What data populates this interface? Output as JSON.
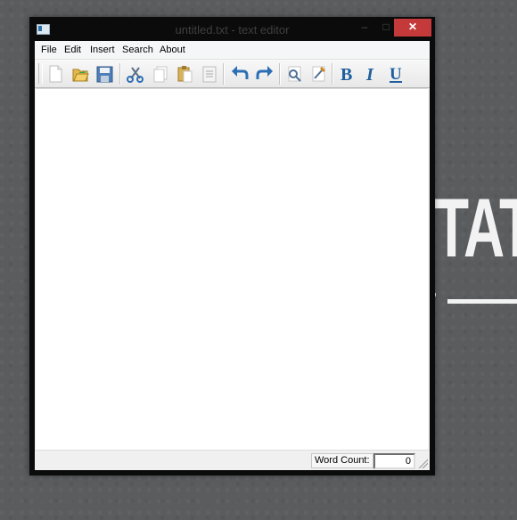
{
  "desktop": {
    "text": "TAT"
  },
  "window": {
    "title": "untitled.txt - text editor",
    "controls": {
      "minimize": "–",
      "maximize": "□",
      "close": "✕"
    }
  },
  "menu": {
    "items": [
      {
        "label": "File"
      },
      {
        "label": "Edit"
      },
      {
        "label": "Insert"
      },
      {
        "label": "Search"
      },
      {
        "label": "About"
      }
    ]
  },
  "toolbar": {
    "buttons": [
      {
        "icon": "new-file-icon"
      },
      {
        "icon": "open-folder-icon"
      },
      {
        "icon": "save-icon"
      },
      {
        "icon": "cut-icon"
      },
      {
        "icon": "copy-icon"
      },
      {
        "icon": "paste-icon"
      },
      {
        "icon": "paste-special-icon"
      },
      {
        "icon": "undo-icon"
      },
      {
        "icon": "redo-icon"
      },
      {
        "icon": "find-icon"
      },
      {
        "icon": "replace-icon"
      },
      {
        "icon": "bold-icon",
        "label": "B"
      },
      {
        "icon": "italic-icon",
        "label": "I"
      },
      {
        "icon": "underline-icon",
        "label": "U"
      }
    ]
  },
  "editor": {
    "content": ""
  },
  "status": {
    "word_count_label": "Word Count:",
    "word_count_value": "0"
  },
  "colors": {
    "desktop": "#5b5c5e",
    "window_frame": "#0b0b0b",
    "close_button": "#c43a3a",
    "accent_blue": "#2d6fb5"
  }
}
